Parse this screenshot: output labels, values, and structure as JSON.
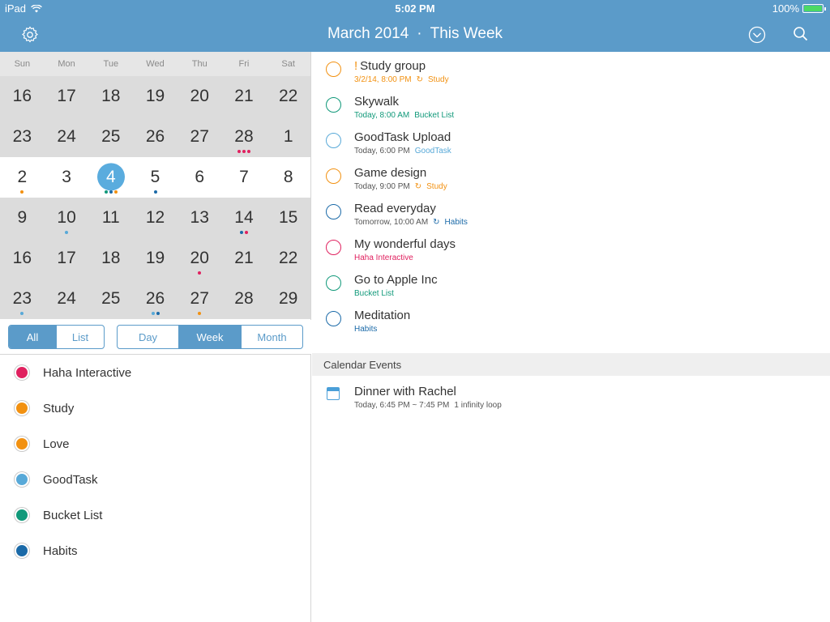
{
  "status": {
    "device": "iPad",
    "time": "5:02 PM",
    "battery": "100%",
    "battery_level": 1.0
  },
  "header": {
    "month": "March 2014",
    "separator": "·",
    "range": "This Week"
  },
  "colors": {
    "accent": "#5b9bc9",
    "haha": "#e0215f",
    "study": "#f29111",
    "love": "#f29111",
    "goodtask": "#58a9d8",
    "bucket": "#11997a",
    "habits": "#1b6aa8"
  },
  "calendar": {
    "weekdays": [
      "Sun",
      "Mon",
      "Tue",
      "Wed",
      "Thu",
      "Fri",
      "Sat"
    ],
    "weeks": [
      {
        "days": [
          {
            "n": "16",
            "dots": []
          },
          {
            "n": "17",
            "dots": []
          },
          {
            "n": "18",
            "dots": []
          },
          {
            "n": "19",
            "dots": []
          },
          {
            "n": "20",
            "dots": []
          },
          {
            "n": "21",
            "dots": []
          },
          {
            "n": "22",
            "dots": []
          }
        ]
      },
      {
        "days": [
          {
            "n": "23",
            "dots": []
          },
          {
            "n": "24",
            "dots": []
          },
          {
            "n": "25",
            "dots": []
          },
          {
            "n": "26",
            "dots": []
          },
          {
            "n": "27",
            "dots": []
          },
          {
            "n": "28",
            "dots": [
              "#e0215f",
              "#e0215f",
              "#e0215f"
            ]
          },
          {
            "n": "1",
            "dots": []
          }
        ]
      },
      {
        "current": true,
        "days": [
          {
            "n": "2",
            "dots": [
              "#f29111"
            ]
          },
          {
            "n": "3",
            "dots": []
          },
          {
            "n": "4",
            "today": true,
            "dots": [
              "#11997a",
              "#1b6aa8",
              "#f29111"
            ]
          },
          {
            "n": "5",
            "dots": [
              "#1b6aa8"
            ]
          },
          {
            "n": "6",
            "dots": []
          },
          {
            "n": "7",
            "dots": []
          },
          {
            "n": "8",
            "dots": []
          }
        ]
      },
      {
        "days": [
          {
            "n": "9",
            "dots": []
          },
          {
            "n": "10",
            "dots": [
              "#58a9d8"
            ]
          },
          {
            "n": "11",
            "dots": []
          },
          {
            "n": "12",
            "dots": []
          },
          {
            "n": "13",
            "dots": []
          },
          {
            "n": "14",
            "dots": [
              "#1b6aa8",
              "#e0215f"
            ]
          },
          {
            "n": "15",
            "dots": []
          }
        ]
      },
      {
        "days": [
          {
            "n": "16",
            "dots": []
          },
          {
            "n": "17",
            "dots": []
          },
          {
            "n": "18",
            "dots": []
          },
          {
            "n": "19",
            "dots": []
          },
          {
            "n": "20",
            "dots": [
              "#e0215f"
            ]
          },
          {
            "n": "21",
            "dots": []
          },
          {
            "n": "22",
            "dots": []
          }
        ]
      },
      {
        "days": [
          {
            "n": "23",
            "dots": [
              "#58a9d8"
            ]
          },
          {
            "n": "24",
            "dots": []
          },
          {
            "n": "25",
            "dots": []
          },
          {
            "n": "26",
            "dots": [
              "#58a9d8",
              "#1b6aa8"
            ]
          },
          {
            "n": "27",
            "dots": [
              "#f29111"
            ]
          },
          {
            "n": "28",
            "dots": []
          },
          {
            "n": "29",
            "dots": []
          }
        ]
      }
    ]
  },
  "filters": {
    "all": "All",
    "list": "List",
    "day": "Day",
    "week": "Week",
    "month": "Month"
  },
  "lists": [
    {
      "name": "Haha Interactive",
      "color": "#e0215f"
    },
    {
      "name": "Study",
      "color": "#f29111"
    },
    {
      "name": "Love",
      "color": "#f29111"
    },
    {
      "name": "GoodTask",
      "color": "#58a9d8"
    },
    {
      "name": "Bucket List",
      "color": "#11997a"
    },
    {
      "name": "Habits",
      "color": "#1b6aa8"
    }
  ],
  "tasks": [
    {
      "title": "Study group",
      "priority": "!",
      "time": "3/2/14, 8:00 PM",
      "repeat": true,
      "list": "Study",
      "color": "#f29111",
      "time_color": "#f29111"
    },
    {
      "title": "Skywalk",
      "time": "Today, 8:00 AM",
      "list": "Bucket List",
      "color": "#11997a",
      "time_color": "#11997a"
    },
    {
      "title": "GoodTask Upload",
      "time": "Today, 6:00 PM",
      "list": "GoodTask",
      "color": "#58a9d8"
    },
    {
      "title": "Game design",
      "time": "Today, 9:00 PM",
      "repeat": true,
      "list": "Study",
      "color": "#f29111"
    },
    {
      "title": "Read everyday",
      "time": "Tomorrow, 10:00 AM",
      "repeat": true,
      "list": "Habits",
      "color": "#1b6aa8"
    },
    {
      "title": "My wonderful days",
      "time": "",
      "list": "Haha Interactive",
      "color": "#e0215f"
    },
    {
      "title": "Go to Apple Inc",
      "time": "",
      "list": "Bucket List",
      "color": "#11997a"
    },
    {
      "title": "Meditation",
      "time": "",
      "list": "Habits",
      "color": "#1b6aa8"
    }
  ],
  "events_section": "Calendar Events",
  "events": [
    {
      "title": "Dinner with Rachel",
      "time": "Today, 6:45 PM ~ 7:45 PM",
      "location": "1 infinity loop"
    }
  ]
}
